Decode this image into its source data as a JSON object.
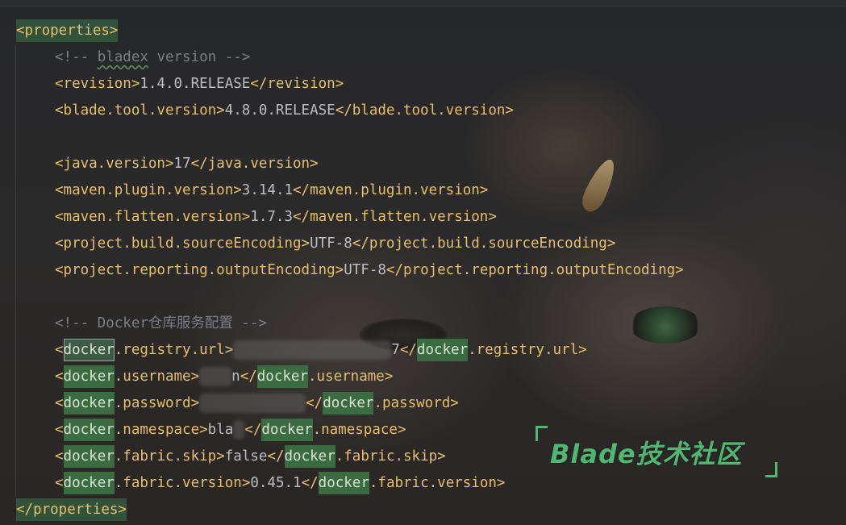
{
  "colors": {
    "tag": "#e8bf6a",
    "text": "#bcbec4",
    "comment": "#7a7e85",
    "highlight": "#3a6b41",
    "watermark": "#4fb772"
  },
  "code": {
    "properties_open": "<properties>",
    "properties_close": "</properties>",
    "comment_bladex_prefix": "<!-- ",
    "comment_bladex_word": "bladex",
    "comment_bladex_suffix": " version -->",
    "revision_open": "<revision>",
    "revision_value": "1.4.0.RELEASE",
    "revision_close": "</revision>",
    "blade_tool_open": "<blade.tool.version>",
    "blade_tool_value": "4.8.0.RELEASE",
    "blade_tool_close": "</blade.tool.version>",
    "java_open": "<java.version>",
    "java_value": "17",
    "java_close": "</java.version>",
    "maven_plugin_open": "<maven.plugin.version>",
    "maven_plugin_value": "3.14.1",
    "maven_plugin_close": "</maven.plugin.version>",
    "maven_flatten_open": "<maven.flatten.version>",
    "maven_flatten_value": "1.7.3",
    "maven_flatten_close": "</maven.flatten.version>",
    "source_enc_open": "<project.build.sourceEncoding>",
    "source_enc_value": "UTF-8",
    "source_enc_close": "</project.build.sourceEncoding>",
    "output_enc_open": "<project.reporting.outputEncoding>",
    "output_enc_value": "UTF-8",
    "output_enc_close": "</project.reporting.outputEncoding>",
    "comment_docker": "<!-- Docker仓库服务配置 -->",
    "lt": "<",
    "lt_slash": "</",
    "gt": ">",
    "docker_word": "docker",
    "registry_rest": ".registry.url",
    "registry_visible_tail": "7",
    "username_rest": ".username",
    "username_visible": "n",
    "password_rest": ".password",
    "namespace_rest": ".namespace",
    "namespace_value": "bla",
    "fabric_skip_rest": ".fabric.skip",
    "fabric_skip_value": "false",
    "fabric_version_rest": ".fabric.version",
    "fabric_version_value": "0.45.1"
  },
  "watermark": {
    "text": "Blade技术社区"
  }
}
